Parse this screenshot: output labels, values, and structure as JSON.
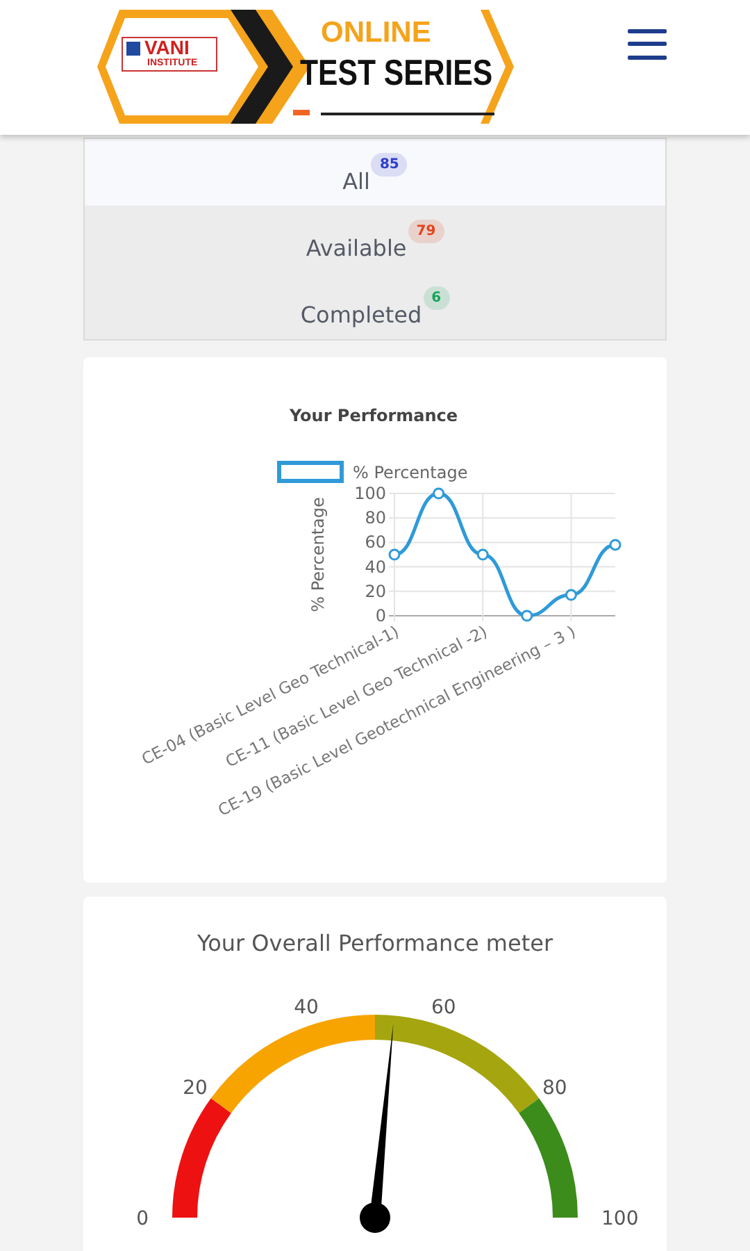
{
  "header": {
    "logo": {
      "brand": "VANI",
      "sub": "INSTITUTE",
      "line_1": "ONLINE",
      "line_2": "TEST SERIES"
    }
  },
  "tabs": [
    {
      "label": "All",
      "count": "85",
      "color": "#2f3fc4",
      "selected": true
    },
    {
      "label": "Available",
      "count": "79",
      "color": "#e2451c",
      "selected": false
    },
    {
      "label": "Completed",
      "count": "6",
      "color": "#17a35a",
      "selected": false
    }
  ],
  "performance_card": {
    "chart_data": {
      "type": "line",
      "title": "Your Performance",
      "ylabel": "% Percentage",
      "categories": [
        "CE-04 (Basic Level Geo Technical-1)",
        null,
        "CE-11 (Basic Level Geo Technical -2)",
        null,
        "CE-19 (Basic Level Geotechnical Engineering – 3 )",
        null
      ],
      "ylim": [
        0,
        100
      ],
      "yticks": [
        0,
        20,
        40,
        60,
        80,
        100
      ],
      "grid": true,
      "series": [
        {
          "name": "% Percentage",
          "color": "#2f9ad8",
          "marker": "circle",
          "values": [
            50,
            100,
            50,
            0,
            17,
            58
          ]
        }
      ]
    }
  },
  "meter_card": {
    "title": "Your Overall Performance meter",
    "level": 0.53,
    "ticks": [
      "0",
      "20",
      "40",
      "60",
      "80",
      "100"
    ]
  }
}
